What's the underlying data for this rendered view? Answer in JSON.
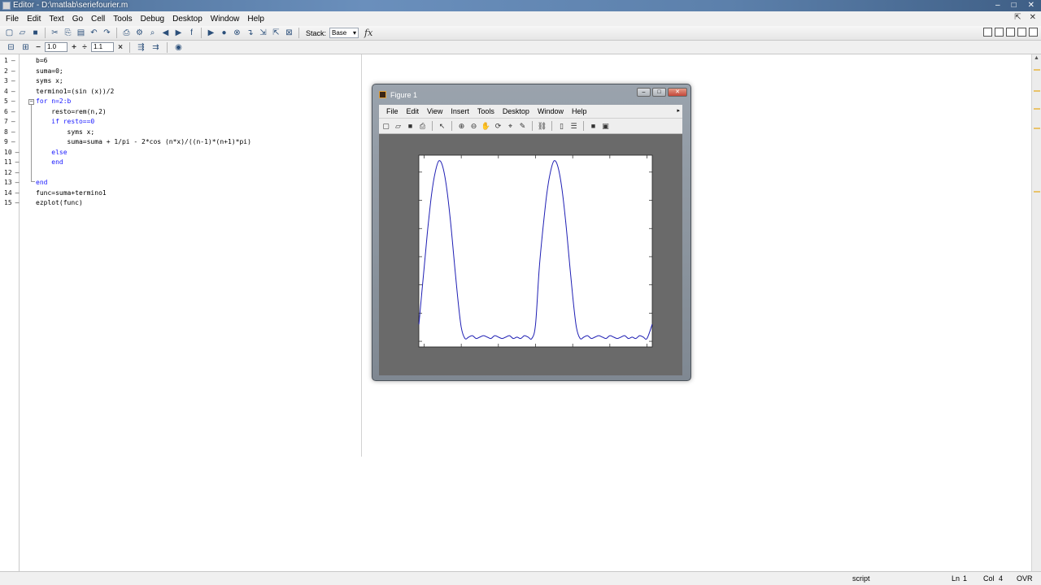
{
  "window": {
    "title": "Editor - D:\\matlab\\seriefourier.m"
  },
  "menubar": {
    "items": [
      "File",
      "Edit",
      "Text",
      "Go",
      "Cell",
      "Tools",
      "Debug",
      "Desktop",
      "Window",
      "Help"
    ]
  },
  "toolbar": {
    "stack_label": "Stack:",
    "stack_value": "Base",
    "fx_label": "fx"
  },
  "celltoolbar": {
    "minus_label": "−",
    "value1": "1.0",
    "plus_label": "+",
    "divide_label": "÷",
    "value2": "1.1",
    "times_label": "×"
  },
  "editor": {
    "lines": [
      {
        "n": "1",
        "code": "b=6"
      },
      {
        "n": "2",
        "code": "suma=0;"
      },
      {
        "n": "3",
        "code": "syms x;"
      },
      {
        "n": "4",
        "code": "termino1=(sin (x))/2"
      },
      {
        "n": "5",
        "code": "for n=2:b"
      },
      {
        "n": "6",
        "code": "    resto=rem(n,2)"
      },
      {
        "n": "7",
        "code": "    if resto==0"
      },
      {
        "n": "8",
        "code": "        syms x;"
      },
      {
        "n": "9",
        "code": "        suma=suma + 1/pi - 2*cos (n*x)/((n-1)*(n+1)*pi)"
      },
      {
        "n": "10",
        "code": "    else"
      },
      {
        "n": "11",
        "code": "    end"
      },
      {
        "n": "12",
        "code": ""
      },
      {
        "n": "13",
        "code": "end"
      },
      {
        "n": "14",
        "code": "func=suma+termino1"
      },
      {
        "n": "15",
        "code": "ezplot(func)"
      }
    ]
  },
  "statusbar": {
    "mode": "script",
    "ln_label": "Ln",
    "ln_value": "1",
    "col_label": "Col",
    "col_value": "4",
    "ovr": "OVR"
  },
  "figure": {
    "title": "Figure 1",
    "menu": [
      "File",
      "Edit",
      "View",
      "Insert",
      "Tools",
      "Desktop",
      "Window",
      "Help"
    ]
  },
  "chart_data": {
    "type": "line",
    "title": "",
    "xlabel": "",
    "ylabel": "",
    "xlim": [
      -6.2832,
      6.2832
    ],
    "ylim": [
      0.18,
      0.86
    ],
    "color": "#1f1fb4",
    "series": [
      {
        "x": [
          -6.28,
          -6.0,
          -5.8,
          -5.6,
          -5.4,
          -5.2,
          -5.0,
          -4.8,
          -4.6,
          -4.4,
          -4.2,
          -4.0,
          -3.8,
          -3.6,
          -3.4,
          -3.2,
          -3.0,
          -2.8,
          -2.6,
          -2.4,
          -2.2,
          -2.0,
          -1.8,
          -1.6,
          -1.4,
          -1.2,
          -1.0,
          -0.8,
          -0.6,
          -0.4,
          -0.2,
          0.0,
          0.2,
          0.4,
          0.6,
          0.8,
          1.0,
          1.2,
          1.4,
          1.6,
          1.8,
          2.0,
          2.2,
          2.4,
          2.6,
          2.8,
          3.0,
          3.2,
          3.4,
          3.6,
          3.8,
          4.0,
          4.2,
          4.4,
          4.6,
          4.8,
          5.0,
          5.2,
          5.4,
          5.6,
          5.8,
          6.0,
          6.28
        ],
        "y": [
          0.26,
          0.46,
          0.6,
          0.72,
          0.8,
          0.84,
          0.82,
          0.75,
          0.64,
          0.5,
          0.36,
          0.25,
          0.21,
          0.215,
          0.22,
          0.21,
          0.215,
          0.22,
          0.215,
          0.21,
          0.22,
          0.215,
          0.21,
          0.215,
          0.22,
          0.21,
          0.215,
          0.21,
          0.22,
          0.215,
          0.21,
          0.26,
          0.46,
          0.6,
          0.72,
          0.8,
          0.84,
          0.82,
          0.75,
          0.64,
          0.5,
          0.36,
          0.25,
          0.21,
          0.215,
          0.22,
          0.21,
          0.215,
          0.22,
          0.215,
          0.21,
          0.22,
          0.215,
          0.21,
          0.215,
          0.22,
          0.21,
          0.215,
          0.21,
          0.22,
          0.215,
          0.21,
          0.26
        ]
      }
    ]
  }
}
